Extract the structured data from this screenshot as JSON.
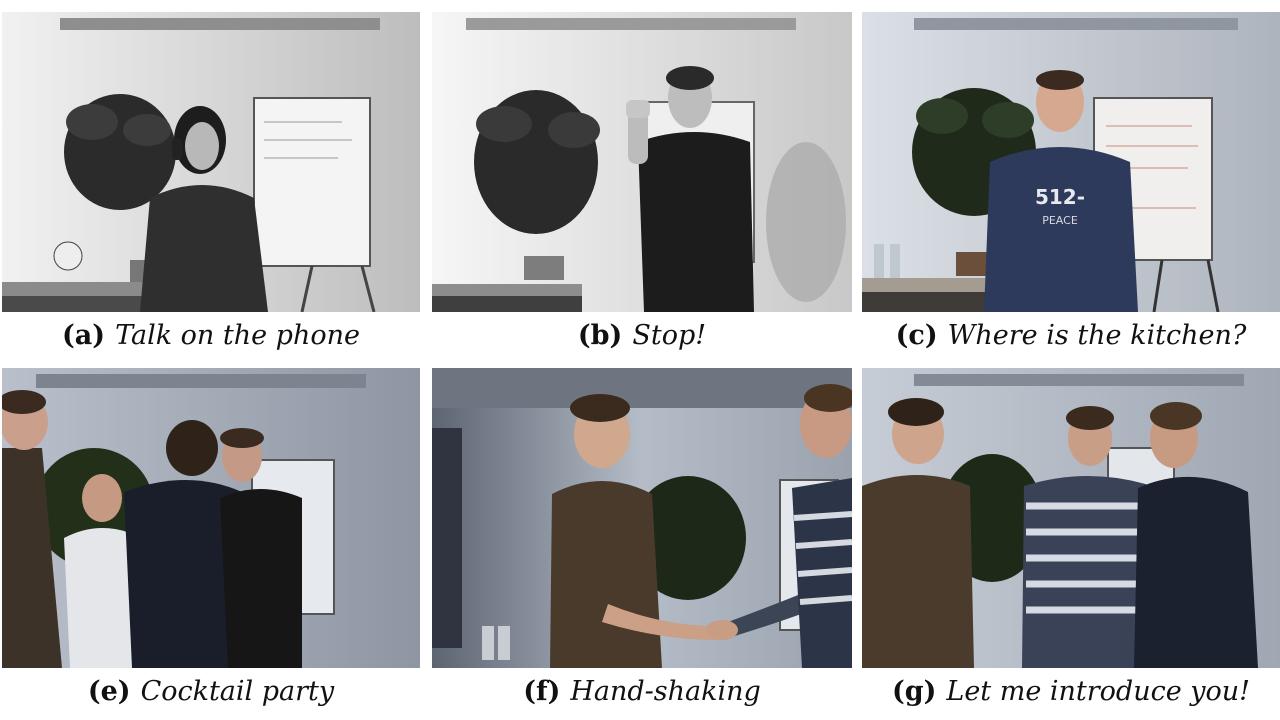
{
  "panels": [
    {
      "id": "a",
      "tag": "(a)",
      "caption": "Talk on the phone",
      "tone": "grayscale"
    },
    {
      "id": "b",
      "tag": "(b)",
      "caption": "Stop!",
      "tone": "grayscale"
    },
    {
      "id": "c",
      "tag": "(c)",
      "caption": "Where is the kitchen?",
      "tone": "color",
      "shirt_print": "512-",
      "shirt_print_sub": "PEACE"
    },
    {
      "id": "e",
      "tag": "(e)",
      "caption": "Cocktail party",
      "tone": "color"
    },
    {
      "id": "f",
      "tag": "(f)",
      "caption": "Hand-shaking",
      "tone": "color"
    },
    {
      "id": "g",
      "tag": "(g)",
      "caption": "Let me introduce you!",
      "tone": "color"
    }
  ],
  "colors": {
    "wall_gray": "#d9d9d9",
    "wall_color": "#dde3ea",
    "plant_dark": "#1f2a1b",
    "navy_shirt": "#2d3a5c",
    "brown_shirt": "#4a3a2c"
  }
}
